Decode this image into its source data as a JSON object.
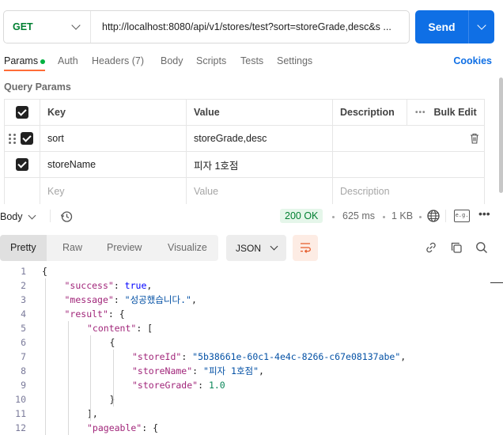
{
  "request": {
    "method": "GET",
    "url": "http://localhost:8080/api/v1/stores/test?sort=storeGrade,desc&s ...",
    "send_label": "Send"
  },
  "tabs": [
    {
      "label": "Params",
      "active": true,
      "has_dot": true
    },
    {
      "label": "Auth"
    },
    {
      "label": "Headers (7)"
    },
    {
      "label": "Body"
    },
    {
      "label": "Scripts"
    },
    {
      "label": "Tests"
    },
    {
      "label": "Settings"
    }
  ],
  "cookies_label": "Cookies",
  "query_params": {
    "title": "Query Params",
    "headers": {
      "key": "Key",
      "value": "Value",
      "description": "Description",
      "bulk_edit": "Bulk Edit"
    },
    "rows": [
      {
        "checked": true,
        "key": "sort",
        "value": "storeGrade,desc",
        "description": ""
      },
      {
        "checked": true,
        "key": "storeName",
        "value": "피자 1호점",
        "description": ""
      }
    ],
    "placeholder": {
      "key": "Key",
      "value": "Value",
      "description": "Description"
    }
  },
  "response": {
    "body_label": "Body",
    "status": "200 OK",
    "time": "625 ms",
    "size": "1 KB",
    "save_icon_text": "e.g."
  },
  "format_tabs": [
    "Pretty",
    "Raw",
    "Preview",
    "Visualize"
  ],
  "format_select": "JSON",
  "code_lines": [
    {
      "n": "1",
      "indent": 0,
      "parts": [
        [
          "p",
          "{"
        ]
      ]
    },
    {
      "n": "2",
      "indent": 1,
      "parts": [
        [
          "k",
          "\"success\""
        ],
        [
          "p",
          ": "
        ],
        [
          "b",
          "true"
        ],
        [
          "p",
          ","
        ]
      ]
    },
    {
      "n": "3",
      "indent": 1,
      "parts": [
        [
          "k",
          "\"message\""
        ],
        [
          "p",
          ": "
        ],
        [
          "s",
          "\"성공했습니다.\""
        ],
        [
          "p",
          ","
        ]
      ]
    },
    {
      "n": "4",
      "indent": 1,
      "parts": [
        [
          "k",
          "\"result\""
        ],
        [
          "p",
          ": {"
        ]
      ]
    },
    {
      "n": "5",
      "indent": 2,
      "parts": [
        [
          "k",
          "\"content\""
        ],
        [
          "p",
          ": ["
        ]
      ]
    },
    {
      "n": "6",
      "indent": 3,
      "parts": [
        [
          "p",
          "{"
        ]
      ]
    },
    {
      "n": "7",
      "indent": 4,
      "parts": [
        [
          "k",
          "\"storeId\""
        ],
        [
          "p",
          ": "
        ],
        [
          "s",
          "\"5b38661e-60c1-4e4c-8266-c67e08137abe\""
        ],
        [
          "p",
          ","
        ]
      ]
    },
    {
      "n": "8",
      "indent": 4,
      "parts": [
        [
          "k",
          "\"storeName\""
        ],
        [
          "p",
          ": "
        ],
        [
          "s",
          "\"피자 1호점\""
        ],
        [
          "p",
          ","
        ]
      ]
    },
    {
      "n": "9",
      "indent": 4,
      "parts": [
        [
          "k",
          "\"storeGrade\""
        ],
        [
          "p",
          ": "
        ],
        [
          "n",
          "1.0"
        ]
      ]
    },
    {
      "n": "10",
      "indent": 3,
      "parts": [
        [
          "p",
          "}"
        ]
      ]
    },
    {
      "n": "11",
      "indent": 2,
      "parts": [
        [
          "p",
          "],"
        ]
      ]
    },
    {
      "n": "12",
      "indent": 2,
      "parts": [
        [
          "k",
          "\"pageable\""
        ],
        [
          "p",
          ": {"
        ]
      ]
    }
  ],
  "colors": {
    "accent": "#0f6fe5",
    "get": "#007f31",
    "tab_underline": "#ff6c37",
    "status_bg": "#e5f6ea"
  }
}
